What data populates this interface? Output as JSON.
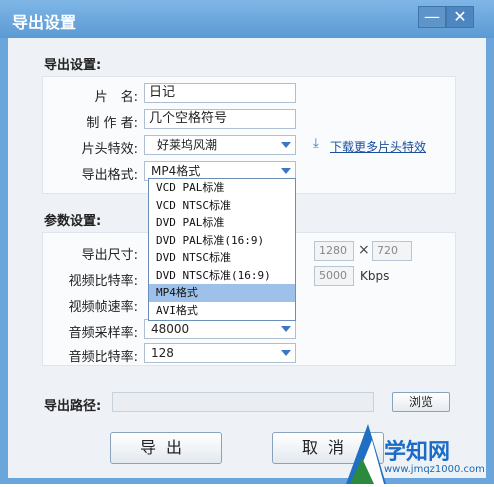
{
  "window": {
    "title": "导出设置",
    "minimize_glyph": "—",
    "close_glyph": "✕"
  },
  "export_section": {
    "label": "导出设置:",
    "title_label": "片　名:",
    "title_value": "日记",
    "author_label": "制 作 者:",
    "author_value": "几个空格符号",
    "effect_label": "片头特效:",
    "effect_value": "好莱坞风潮",
    "download_link": "下载更多片头特效",
    "format_label": "导出格式:",
    "format_value": "MP4格式",
    "format_options": [
      "VCD PAL标准",
      "VCD NTSC标准",
      "DVD PAL标准",
      "DVD PAL标准(16:9)",
      "DVD NTSC标准",
      "DVD NTSC标准(16:9)",
      "MP4格式",
      "AVI格式"
    ],
    "selected_index": 6
  },
  "params_section": {
    "label": "参数设置:",
    "size_label": "导出尺寸:",
    "width_value": "1280",
    "times": "×",
    "height_value": "720",
    "bitrate_label": "视频比特率:",
    "bitrate_value": "5000",
    "bitrate_unit": "Kbps",
    "framerate_label": "视频帧速率:",
    "samplerate_label": "音频采样率:",
    "samplerate_value": "48000",
    "audio_bitrate_label": "音频比特率:",
    "audio_bitrate_value": "128"
  },
  "path_section": {
    "label": "导出路径:",
    "browse_label": "浏览"
  },
  "buttons": {
    "export_label": "导出",
    "cancel_label": "取消"
  },
  "watermark": {
    "brand": "学知网",
    "url": "www.jmqz1000.com"
  },
  "colors": {
    "title_bar": "#5b9ad3",
    "accent": "#3b78c4",
    "selection": "#9ec1ea",
    "link": "#1a4f9c"
  }
}
